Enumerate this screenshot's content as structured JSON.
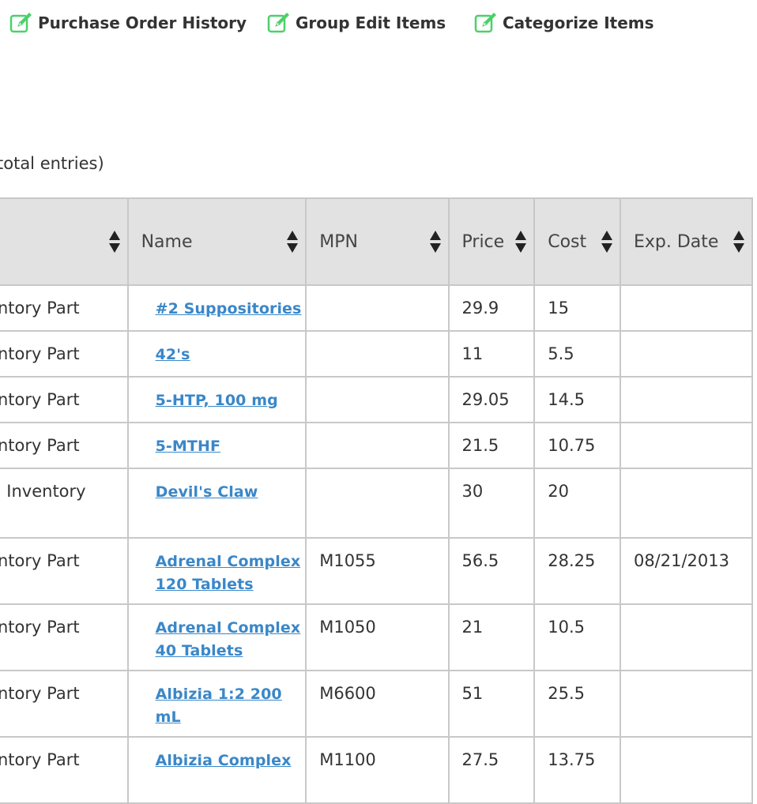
{
  "toolbar": {
    "links": [
      {
        "label": "Purchase Order History",
        "icon": "edit-icon"
      },
      {
        "label": "Group Edit Items",
        "icon": "edit-icon"
      },
      {
        "label": "Categorize Items",
        "icon": "edit-icon"
      }
    ],
    "icon_color": "#4cd06a"
  },
  "entries_info": "total entries)",
  "table": {
    "columns": [
      "",
      "Name",
      "MPN",
      "Price",
      "Cost",
      "Exp. Date"
    ],
    "rows": [
      {
        "type": "ntory Part",
        "name": "#2 Suppositories",
        "mpn": "",
        "price": "29.9",
        "cost": "15",
        "exp": ""
      },
      {
        "type": "ntory Part",
        "name": "42's",
        "mpn": "",
        "price": "11",
        "cost": "5.5",
        "exp": ""
      },
      {
        "type": "ntory Part",
        "name": "5-HTP, 100 mg",
        "mpn": "",
        "price": "29.05",
        "cost": "14.5",
        "exp": ""
      },
      {
        "type": "ntory Part",
        "name": "5-MTHF",
        "mpn": "",
        "price": "21.5",
        "cost": "10.75",
        "exp": ""
      },
      {
        "type": "Inventory",
        "name": "Devil's Claw",
        "mpn": "",
        "price": "30",
        "cost": "20",
        "exp": ""
      },
      {
        "type": "ntory Part",
        "name": "Adrenal Complex 120 Tablets",
        "mpn": "M1055",
        "price": "56.5",
        "cost": "28.25",
        "exp": "08/21/2013"
      },
      {
        "type": "ntory Part",
        "name": "Adrenal Complex 40 Tablets",
        "mpn": "M1050",
        "price": "21",
        "cost": "10.5",
        "exp": ""
      },
      {
        "type": "ntory Part",
        "name": "Albizia 1:2 200 mL",
        "mpn": "M6600",
        "price": "51",
        "cost": "25.5",
        "exp": ""
      },
      {
        "type": "ntory Part",
        "name": "Albizia Complex",
        "mpn": "M1100",
        "price": "27.5",
        "cost": "13.75",
        "exp": ""
      }
    ]
  },
  "colors": {
    "link": "#3a87c8",
    "header_bg": "#e2e2e2",
    "border": "#c8c8c8"
  }
}
